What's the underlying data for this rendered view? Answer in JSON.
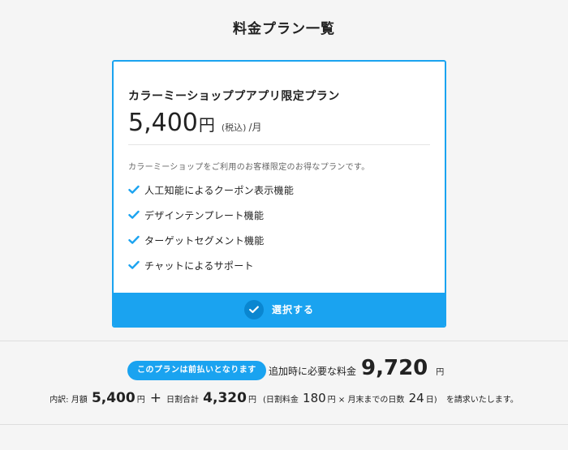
{
  "page": {
    "title": "料金プラン一覧"
  },
  "plan": {
    "name": "カラーミーショッププアプリ限定プラン",
    "price_amount": "5,400",
    "price_unit": "円",
    "price_tax": "(税込)",
    "price_period": "/月",
    "description": "カラーミーショップをご利用のお客様限定のお得なプランです。",
    "features": [
      "人工知能によるクーポン表示機能",
      "デザインテンプレート機能",
      "ターゲットセグメント機能",
      "チャットによるサポート"
    ],
    "select_label": "選択する"
  },
  "summary": {
    "badge": "このプランは前払いとなります",
    "total_label": "追加時に必要な料金",
    "total_amount": "9,720",
    "total_unit": "円",
    "breakdown": {
      "prefix": "内訳: 月額",
      "monthly": "5,400",
      "yen1": "円",
      "plus": "+",
      "prorate_label": "日割合計",
      "prorate": "4,320",
      "yen2": "円",
      "daily_label": "(日割料金",
      "daily": "180",
      "yen3": "円",
      "times": "×",
      "days_label": "月末までの日数",
      "days": "24",
      "day_unit": "日)",
      "suffix": "を請求いたします。"
    }
  },
  "colors": {
    "accent": "#1aa3f0",
    "accent_dark": "#0a86d0"
  },
  "icons": {
    "feature": "check-icon",
    "button": "check-circle-icon"
  }
}
